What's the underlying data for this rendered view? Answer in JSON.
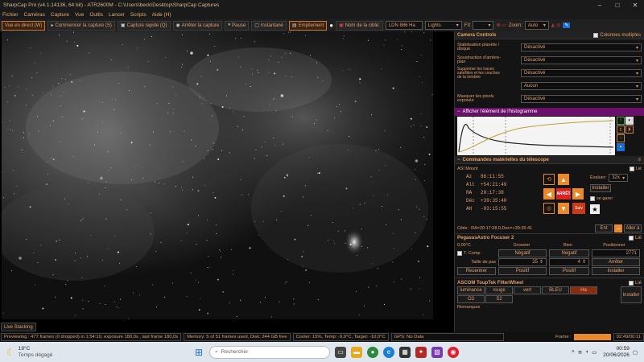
{
  "window": {
    "title": "SharpCap Pro (v4.1.14136, 64 bit) - ATR2600M - C:\\Users\\beck\\Desktop\\SharpCap Captures"
  },
  "menu": [
    "Fichier",
    "Caméras",
    "Capture",
    "Vue",
    "Outils",
    "Lancer",
    "Scripts",
    "Aide (H)"
  ],
  "toolbar": {
    "live_view": "Vue en direct (W)",
    "start_capture": "Commencer la capture (S)",
    "quick_capture": "Capture rapide (Q)",
    "stop_capture": "Arrêter la capture",
    "pause": "Pause",
    "snapshot": "Instantané",
    "stacking": "Empilement",
    "target_label": "Nom de la cible:",
    "target_value": "LDN 886 Ha",
    "frame_type": "Lights",
    "fx_label": "FX",
    "zoom_label": "Zoom:",
    "zoom_value": "Auto"
  },
  "camera_controls": {
    "title": "Camera Controls",
    "multi_columns": "Colonnes multiples",
    "rows": [
      {
        "label": "Stabilisation planète / disque",
        "value": "Désactivé"
      },
      {
        "label": "Soustraction d'arrière-plan",
        "value": "Désactivé"
      },
      {
        "label": "Supprimer les traces satellites et les couches de la tombée",
        "value": "Désactivé"
      },
      {
        "label": "",
        "value": "Aucun"
      },
      {
        "label": "Masquer les pixels exposés",
        "value": "Désactivé"
      }
    ]
  },
  "histogram": {
    "title": "Afficher l'élément de l'histogramme"
  },
  "telescope": {
    "title": "Commandes matérielles du télescope",
    "mount_label": "ASI Mount",
    "linked_label": "Lié",
    "coords": [
      {
        "k": "Az",
        "v": "86:11:55"
      },
      {
        "k": "Alt",
        "v": "+54:21:49"
      },
      {
        "k": "RA",
        "v": "20:17:38"
      },
      {
        "k": "Déc",
        "v": "+39:35:40"
      },
      {
        "k": "AH",
        "v": "-03:15:55"
      }
    ],
    "rate_label": "Évaluer:",
    "rate_value": "32x",
    "install_btn": "Installer",
    "park_label": "se garer",
    "stop_label": "ARRÊT",
    "follow_btn": "Suiv",
    "target_line": "Cible : RA=20:17:28.0,Dec=+39:35:41",
    "goto_btn": "Ent",
    "goto2_btn": "Aller à"
  },
  "focuser": {
    "title": "PegasusAstro Focuser 2",
    "linked_label": "Lié",
    "temp": "0,00°C",
    "coarse": "Grossier",
    "fine": "Bien",
    "position": "Positionner",
    "tcomp": "T. Comp",
    "neg1": "Négatif",
    "neg2": "Négatif",
    "position_value": "2771",
    "step_label": "Taille de pas",
    "step1": "25",
    "step2": "4",
    "stop_btn": "Arrêter",
    "reverse_btn": "Recentrer",
    "pos1": "Positif",
    "pos2": "Positif",
    "install_btn": "Installer"
  },
  "filterwheel": {
    "title": "ASCOM ToupTek FilterWheel",
    "linked_label": "Lié",
    "filters": [
      "luminance",
      "rouge",
      "vert",
      "BLEU",
      "Ha",
      "O3",
      "S2"
    ],
    "install_btn": "Installer",
    "remarks": "Remarques"
  },
  "viewer_tab": "Live Stacking",
  "status": {
    "previewing": "Previewing : 477 frames (0 dropped) in 1:54:10, exposure 180,0s , last frame 180,0s",
    "memory": "Memory: 5 of 51 frames used, Disk: 244 GB free",
    "cooler": "Cooler: 15%, Temp: -9,9°C, Target: -10,0°C",
    "gps": "GPS: No Data",
    "frame_label": "Frame :",
    "frame_time": "02:49/00:11"
  },
  "taskbar": {
    "weather_temp": "19°C",
    "weather_desc": "Temps dégagé",
    "search_placeholder": "Rechercher",
    "time": "00:59",
    "date": "20/06/2026"
  }
}
